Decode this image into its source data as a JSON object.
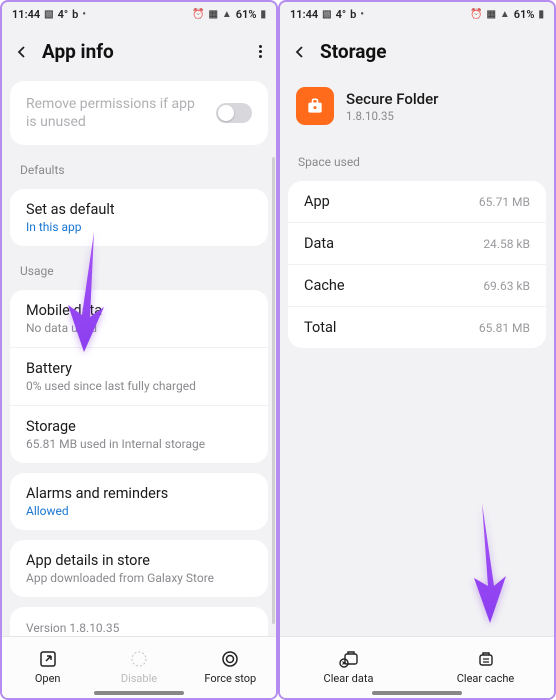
{
  "status": {
    "time": "11:44",
    "temp": "4°",
    "brand": "b",
    "battery": "61%"
  },
  "left": {
    "title": "App info",
    "remove_perm_label": "Remove permissions if app is unused",
    "defaults_label": "Defaults",
    "set_default": {
      "title": "Set as default",
      "sub": "In this app"
    },
    "usage_label": "Usage",
    "mobile_data": {
      "title": "Mobile data",
      "sub": "No data used"
    },
    "battery": {
      "title": "Battery",
      "sub": "0% used since last fully charged"
    },
    "storage": {
      "title": "Storage",
      "sub": "65.81 MB used in Internal storage"
    },
    "alarms": {
      "title": "Alarms and reminders",
      "sub": "Allowed"
    },
    "details": {
      "title": "App details in store",
      "sub": "App downloaded from Galaxy Store"
    },
    "version": "Version 1.8.10.35",
    "btn_open": "Open",
    "btn_disable": "Disable",
    "btn_force": "Force stop"
  },
  "right": {
    "title": "Storage",
    "app_name": "Secure Folder",
    "app_version": "1.8.10.35",
    "space_used_label": "Space used",
    "rows": {
      "app": {
        "label": "App",
        "value": "65.71 MB"
      },
      "data": {
        "label": "Data",
        "value": "24.58 kB"
      },
      "cache": {
        "label": "Cache",
        "value": "69.63 kB"
      },
      "total": {
        "label": "Total",
        "value": "65.81 MB"
      }
    },
    "btn_clear_data": "Clear data",
    "btn_clear_cache": "Clear cache"
  }
}
